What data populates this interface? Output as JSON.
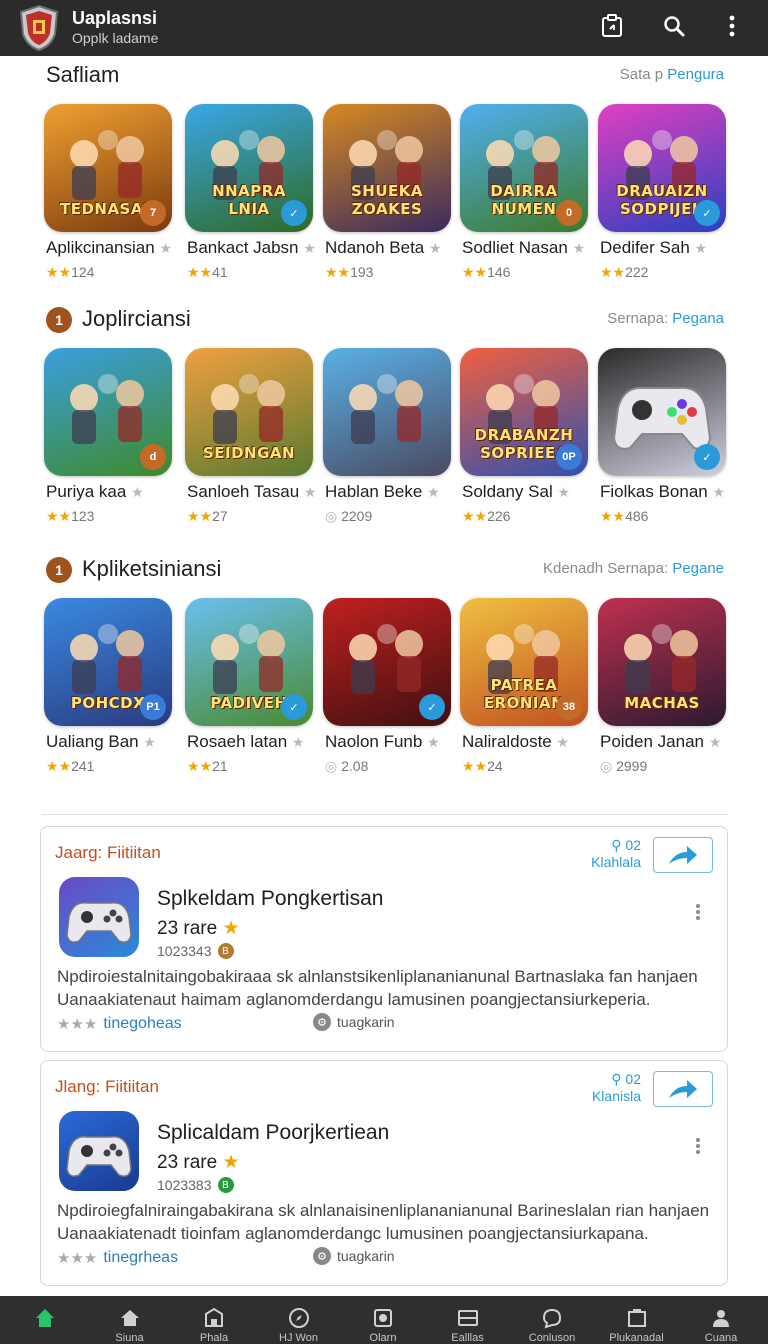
{
  "header": {
    "title": "Uaplasnsi",
    "subtitle": "Opplk ladame",
    "icons": [
      "clipboard-icon",
      "search-icon",
      "more-vert-icon"
    ]
  },
  "sections": [
    {
      "title": "Safliam",
      "number": "",
      "link_prefix": "Sata p",
      "link_text": "Pengura",
      "apps": [
        {
          "name": "Aplikcinansian",
          "rating": "124",
          "art": "TEDNASAN",
          "badge": "7",
          "badge_type": "orange",
          "bg": [
            "#f0a030",
            "#7a3b10"
          ],
          "icon": "game-art-icon"
        },
        {
          "name": "Bankact Jabsn",
          "rating": "41",
          "art": "NNAPRA LNIA",
          "badge": "✓",
          "badge_type": "check",
          "bg": [
            "#3aa7e8",
            "#2f6a24"
          ],
          "icon": "game-art-icon"
        },
        {
          "name": "Ndanoh Beta",
          "rating": "193",
          "art": "SHUEKA ZOAKES",
          "badge": "",
          "badge_type": "none",
          "bg": [
            "#d88a20",
            "#3a2a60"
          ],
          "icon": "game-art-icon"
        },
        {
          "name": "Sodliet Nasan",
          "rating": "146",
          "art": "DAIRRA NUMEN",
          "badge": "0",
          "badge_type": "orange",
          "bg": [
            "#4fb0f0",
            "#3e7a2a"
          ],
          "icon": "game-art-icon"
        },
        {
          "name": "Dedifer Sah",
          "rating": "222",
          "art": "DRAUAIZN SODPIJEK",
          "badge": "✓",
          "badge_type": "check",
          "bg": [
            "#e040c0",
            "#2a40c0"
          ],
          "icon": "game-art-icon"
        }
      ]
    },
    {
      "title": "Joplirciansi",
      "number": "1",
      "link_prefix": "Sernapa:",
      "link_text": "Pegana",
      "apps": [
        {
          "name": "Puriya kaa",
          "rating": "123",
          "art": "",
          "badge": "d",
          "badge_type": "orange",
          "bg": [
            "#3a9fe0",
            "#3f8a2a"
          ],
          "icon": "game-art-icon"
        },
        {
          "name": "Sanloeh Tasau",
          "rating": "27",
          "art": "SEIDNGAN",
          "badge": "",
          "badge_type": "none",
          "bg": [
            "#f0a040",
            "#5a7a30"
          ],
          "icon": "game-art-icon"
        },
        {
          "name": "Hablan Beke",
          "rating": "2209",
          "art": "",
          "badge": "",
          "badge_type": "none",
          "bg": [
            "#5ab0e8",
            "#4a4a60"
          ],
          "icon": "game-art-icon"
        },
        {
          "name": "Soldany Sal",
          "rating": "226",
          "art": "DRABANZH SOPRIEEA",
          "badge": "0P",
          "badge_type": "blue",
          "bg": [
            "#f06040",
            "#3050b0"
          ],
          "icon": "game-art-icon"
        },
        {
          "name": "Fiolkas Bonan",
          "rating": "486",
          "art": "",
          "badge": "✓",
          "badge_type": "check",
          "bg": [
            "#2a2a2a",
            "#d0d0e0"
          ],
          "icon": "gamepad-icon"
        }
      ]
    },
    {
      "title": "Kpliketsiniansi",
      "number": "1",
      "link_prefix": "Kdenadh Sernapa:",
      "link_text": "Pegane",
      "apps": [
        {
          "name": "Ualiang Ban",
          "rating": "241",
          "art": "POHCDX",
          "badge": "P1",
          "badge_type": "blue",
          "bg": [
            "#3a8ae0",
            "#2a3a80"
          ],
          "icon": "game-art-icon"
        },
        {
          "name": "Rosaeh latan",
          "rating": "21",
          "art": "PADIVEH",
          "badge": "✓",
          "badge_type": "check",
          "bg": [
            "#6ac0f0",
            "#4a8a30"
          ],
          "icon": "game-art-icon"
        },
        {
          "name": "Naolon Funb",
          "rating": "2.08",
          "art": "",
          "badge": "✓",
          "badge_type": "check",
          "bg": [
            "#c02020",
            "#401010"
          ],
          "icon": "game-art-icon"
        },
        {
          "name": "Naliraldoste",
          "rating": "24",
          "art": "PATREA ERONIAN",
          "badge": "38",
          "badge_type": "orange",
          "bg": [
            "#f0c040",
            "#c05020"
          ],
          "icon": "game-art-icon"
        },
        {
          "name": "Poiden Janan",
          "rating": "2999",
          "art": "MACHAS",
          "badge": "",
          "badge_type": "none",
          "bg": [
            "#c03050",
            "#2a1a30"
          ],
          "icon": "game-art-icon"
        }
      ]
    }
  ],
  "cards": [
    {
      "label": "Jaarg: Fiitiitan",
      "count": "02",
      "count_label": "Klahlala",
      "title": "Splkeldam Pongkertisan",
      "rate": "23 rare",
      "downloads": "1023343",
      "dl_badge": "B",
      "dl_color": "#b07a30",
      "desc1": "Npdiroiestalnitaingobakiraaa sk alnlanstsikenliplananianunal Bartnaslaka fan hanjaen",
      "desc2": "Uanaakiatenaut haimam aglanomderdangu lamusinen poangjectansiurkeperia.",
      "foot": "tinegoheas",
      "tag": "tuagkarin"
    },
    {
      "label": "Jlang: Fiitiitan",
      "count": "02",
      "count_label": "Klanisla",
      "title": "Splicaldam Poorjkertiean",
      "rate": "23 rare",
      "downloads": "1023383",
      "dl_badge": "B",
      "dl_color": "#2a9a40",
      "desc1": "Npdiroiegfalniraingabakirana sk alnlanaisinenliplananianunal Barineslalan rian hanjaen",
      "desc2": "Uanaakiatenadt tioinfam aglanomderdangc lumusinen poangjectansiurkapana.",
      "foot": "tinegrheas",
      "tag": "tuagkarin"
    }
  ],
  "nav": [
    {
      "label": "",
      "icon": "home-icon"
    },
    {
      "label": "Siuna",
      "icon": "house-icon"
    },
    {
      "label": "Phala",
      "icon": "store-icon"
    },
    {
      "label": "HJ Won",
      "icon": "compass-icon"
    },
    {
      "label": "Olarn",
      "icon": "camera-icon"
    },
    {
      "label": "Ealllas",
      "icon": "tray-icon"
    },
    {
      "label": "Conluson",
      "icon": "chat-icon"
    },
    {
      "label": "Plukanadal",
      "icon": "archive-icon"
    },
    {
      "label": "Cuana",
      "icon": "person-icon"
    }
  ],
  "colors": {
    "accent_blue": "#2a9bd8",
    "label_orange": "#c0501d",
    "star_yellow": "#f0a500",
    "active_nav": "#29c46a",
    "topbar": "#2b2b2b"
  }
}
